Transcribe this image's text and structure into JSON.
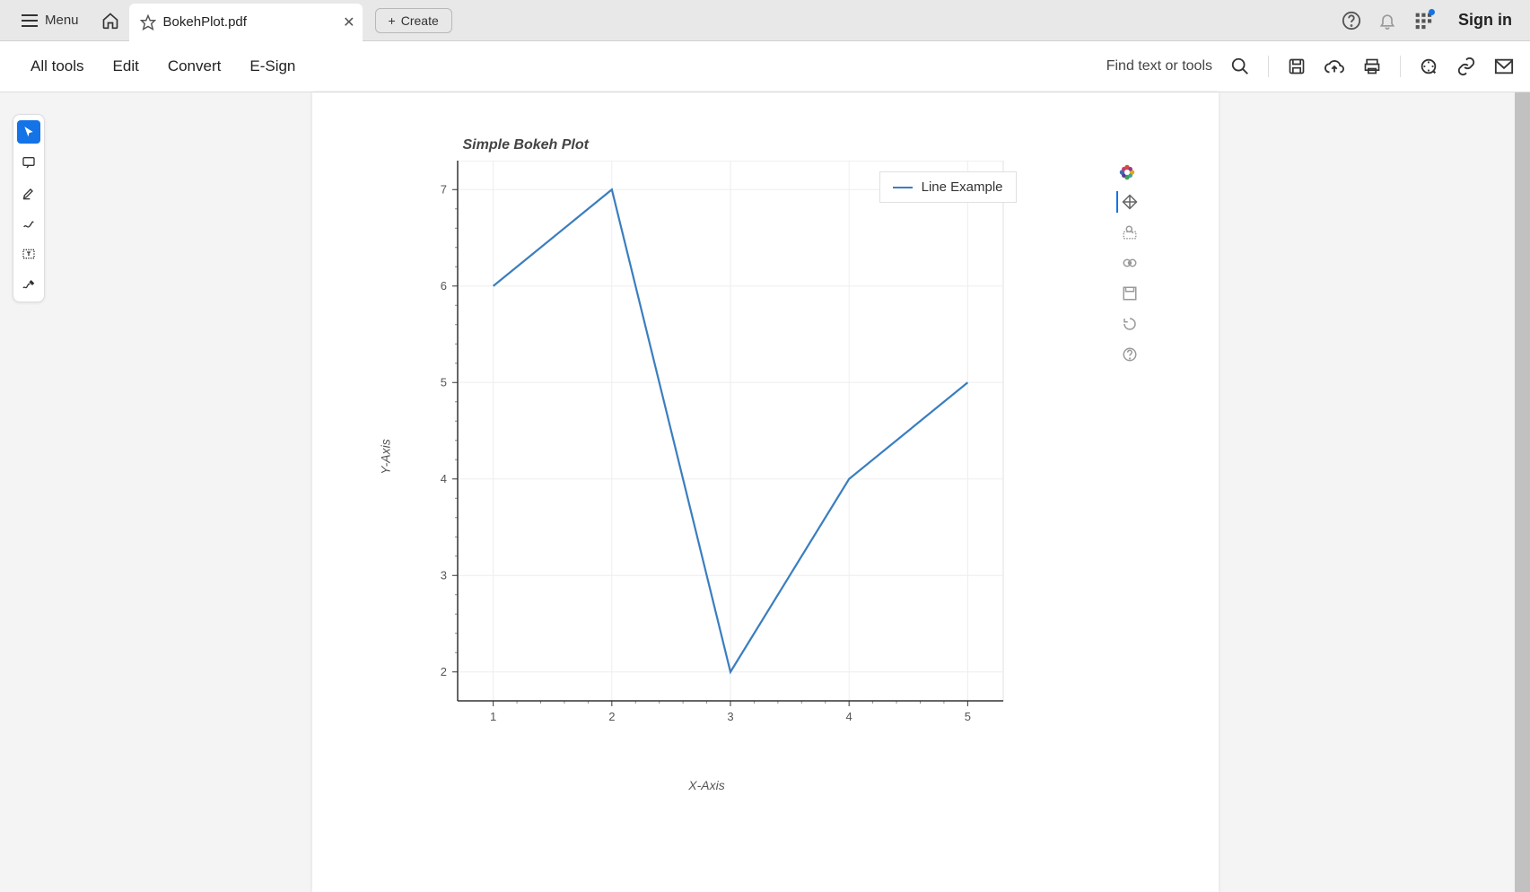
{
  "header": {
    "menu_label": "Menu",
    "filename": "BokehPlot.pdf",
    "create_label": "Create",
    "sign_in_label": "Sign in"
  },
  "toolbar": {
    "tabs": [
      "All tools",
      "Edit",
      "Convert",
      "E-Sign"
    ],
    "find_placeholder": "Find text or tools"
  },
  "chart_data": {
    "type": "line",
    "title": "Simple Bokeh Plot",
    "xlabel": "X-Axis",
    "ylabel": "Y-Axis",
    "x": [
      1,
      2,
      3,
      4,
      5
    ],
    "y": [
      6,
      7,
      2,
      4,
      5
    ],
    "xlim": [
      0.7,
      5.3
    ],
    "ylim": [
      1.7,
      7.3
    ],
    "legend": "Line Example",
    "xticks": [
      1,
      2,
      3,
      4,
      5
    ],
    "yticks": [
      2,
      3,
      4,
      5,
      6,
      7
    ]
  }
}
